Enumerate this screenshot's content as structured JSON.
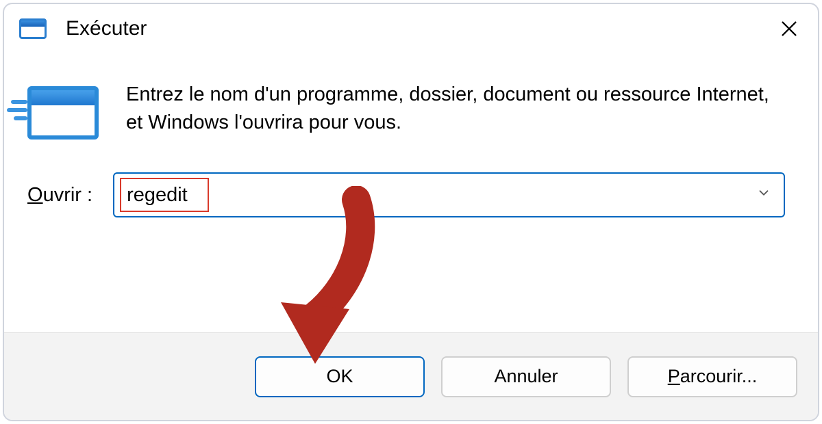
{
  "window": {
    "title": "Exécuter"
  },
  "content": {
    "description": "Entrez le nom d'un programme, dossier, document ou ressource Internet, et Windows l'ouvrira pour vous.",
    "open_label_underline": "O",
    "open_label_rest": "uvrir :",
    "input_value": "regedit"
  },
  "buttons": {
    "ok": "OK",
    "cancel": "Annuler",
    "browse_underline": "P",
    "browse_rest": "arcourir..."
  },
  "colors": {
    "accent": "#0067c0",
    "highlight": "#d93a2b",
    "arrow": "#b12a1f"
  }
}
